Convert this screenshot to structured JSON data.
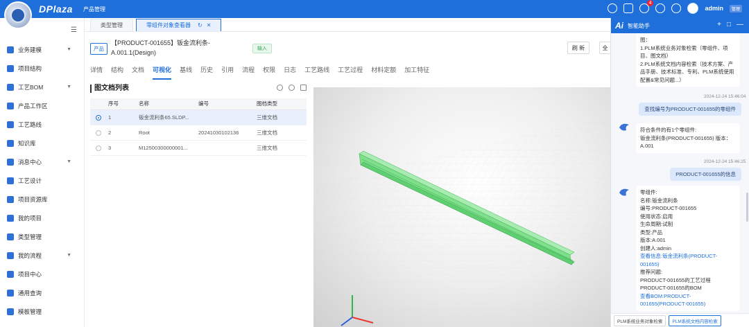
{
  "topbar": {
    "brand": "DPlaza",
    "module": "产品管理",
    "notifications": "4",
    "user": "admin",
    "role": "管理"
  },
  "sidebar": {
    "items": [
      {
        "label": "业务建模",
        "caret": true
      },
      {
        "label": "项目结构",
        "caret": false
      },
      {
        "label": "工艺BOM",
        "caret": true
      },
      {
        "label": "产品工作区",
        "caret": false
      },
      {
        "label": "工艺路线",
        "caret": false
      },
      {
        "label": "知识库",
        "caret": false
      },
      {
        "label": "消息中心",
        "caret": true
      },
      {
        "label": "工艺设计",
        "caret": false
      },
      {
        "label": "项目资源库",
        "caret": false
      },
      {
        "label": "我的项目",
        "caret": false
      },
      {
        "label": "类型管理",
        "caret": false
      },
      {
        "label": "我的流程",
        "caret": true
      },
      {
        "label": "项目中心",
        "caret": false
      },
      {
        "label": "通用查询",
        "caret": false
      },
      {
        "label": "模板管理",
        "caret": false
      }
    ]
  },
  "tabs": [
    {
      "label": "类型管理",
      "active": false
    },
    {
      "label": "零组件对象查看器",
      "active": true
    }
  ],
  "product": {
    "tag": "产品",
    "title_line1": "【PRODUCT-001655】钣金流利条-",
    "title_line2": "A.001.1(Design)",
    "status": "输入",
    "refresh_label": "刷 新",
    "more_label": "全"
  },
  "subtabs": [
    "详情",
    "结构",
    "文档",
    "可视化",
    "基线",
    "历史",
    "引用",
    "流程",
    "权限",
    "日志",
    "工艺路线",
    "工艺过程",
    "材料定额",
    "加工特征"
  ],
  "active_subtab": "可视化",
  "doc_list": {
    "title": "图文档列表",
    "columns": [
      "序号",
      "名称",
      "编号",
      "图档类型"
    ],
    "rows": [
      {
        "no": "1",
        "name": "钣金流利条65.SLDP...",
        "code": "",
        "type": "三维文档",
        "selected": true
      },
      {
        "no": "2",
        "name": "Root",
        "code": "20241030102136",
        "type": "三维文档",
        "selected": false
      },
      {
        "no": "3",
        "name": "M12500300000001...",
        "code": "",
        "type": "三维文档",
        "selected": false
      }
    ]
  },
  "ai": {
    "logo": "Ai",
    "title": "智能助手",
    "intro_lines": [
      "图：",
      "1.PLM系统业务对象检索（零组件、项目、图文档）",
      "2.PLM系统文档内容检索（技术方案、产品手册、技术标准、专利、PLM系统使用配置&常见问题...）"
    ],
    "ts1": "2024-12-24 15:46:04",
    "q1": "查找编号为PRODUCT-001655的零组件",
    "a1_lines": [
      "符合条件的有1个零组件:",
      "钣金流利条(PRODUCT-001655) 版本：A.001"
    ],
    "ts2": "2024-12-24 15:46:25",
    "q2": "PRODUCT-001655的信息",
    "a2_lines": [
      "零组件:",
      "名称:钣金流利条",
      "编号:PRODUCT-001655",
      "使用状态:启用",
      "生命周期:试制",
      "类型:产品",
      "版本:A.001",
      "创建人:admin"
    ],
    "a2_link1": "查看信息:钣金流利条(PRODUCT-001655)",
    "a2_more_lines": [
      "推荐问题:",
      "PRODUCT-001655的工艺过程",
      "PRODUCT-001655的BOM"
    ],
    "a2_link2": "查看BOM:PRODUCT-001655(PRODUCT-001655)",
    "chips": [
      "PLM系统业务对象检索",
      "PLM系统文档内容检索"
    ]
  },
  "colors": {
    "primary": "#1e6fd9",
    "part_green": "#7ee08a"
  }
}
